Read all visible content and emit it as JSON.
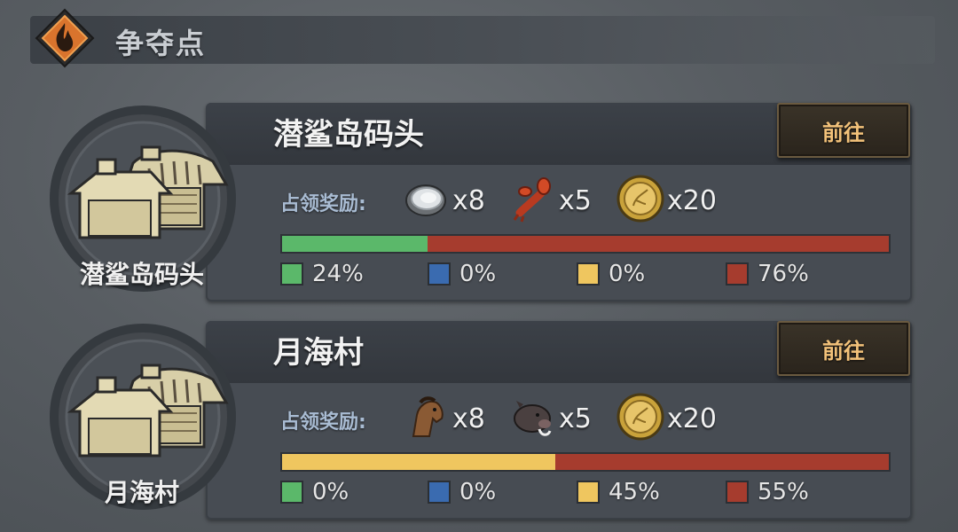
{
  "header": {
    "title": "争夺点",
    "icon": "flame-icon"
  },
  "colors": {
    "green": "#5bb86a",
    "blue": "#3a6bb0",
    "yellow": "#efc65f",
    "red": "#a63c2e"
  },
  "locations": [
    {
      "name": "潜鲨岛码头",
      "emblem_label": "潜鲨岛码头",
      "go_label": "前往",
      "reward_label": "占领奖励:",
      "rewards": [
        {
          "icon": "oyster-icon",
          "qty": "x8"
        },
        {
          "icon": "lobster-icon",
          "qty": "x5"
        },
        {
          "icon": "gold-coin-icon",
          "qty": "x20"
        }
      ],
      "shares": [
        {
          "color": "green",
          "value": 24,
          "label": "24%"
        },
        {
          "color": "blue",
          "value": 0,
          "label": "0%"
        },
        {
          "color": "yellow",
          "value": 0,
          "label": "0%"
        },
        {
          "color": "red",
          "value": 76,
          "label": "76%"
        }
      ]
    },
    {
      "name": "月海村",
      "emblem_label": "月海村",
      "go_label": "前往",
      "reward_label": "占领奖励:",
      "rewards": [
        {
          "icon": "horse-icon",
          "qty": "x8"
        },
        {
          "icon": "boar-icon",
          "qty": "x5"
        },
        {
          "icon": "gold-coin-icon",
          "qty": "x20"
        }
      ],
      "shares": [
        {
          "color": "green",
          "value": 0,
          "label": "0%"
        },
        {
          "color": "blue",
          "value": 0,
          "label": "0%"
        },
        {
          "color": "yellow",
          "value": 45,
          "label": "45%"
        },
        {
          "color": "red",
          "value": 55,
          "label": "55%"
        }
      ]
    }
  ]
}
